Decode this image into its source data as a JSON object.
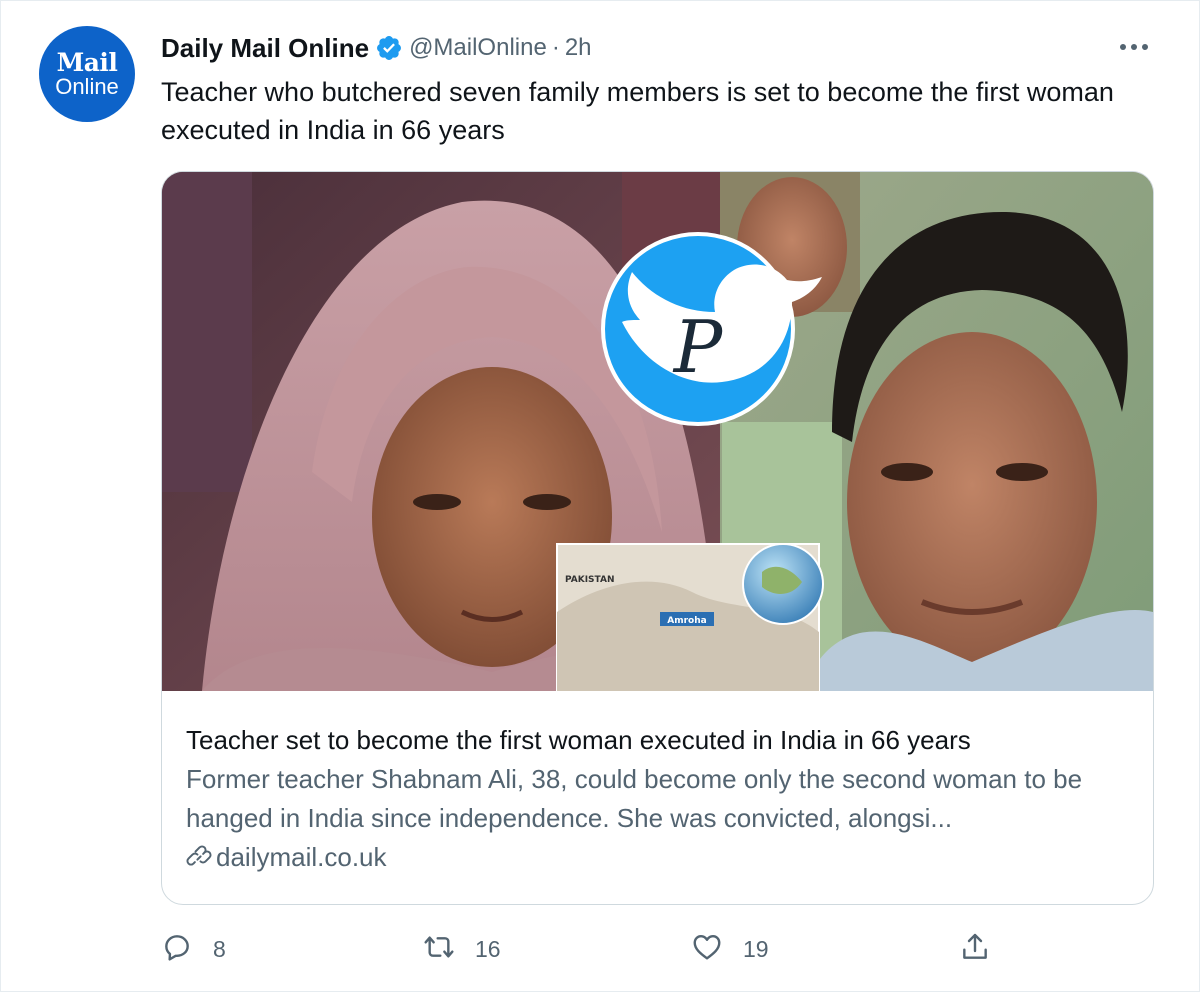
{
  "account": {
    "avatar_line1": "Mail",
    "avatar_line2": "Online",
    "display_name": "Daily Mail Online",
    "handle": "@MailOnline",
    "separator": "·",
    "time": "2h"
  },
  "tweet": {
    "text": "Teacher who butchered seven family members is set to become the first woman executed in India in 66 years"
  },
  "card": {
    "title": "Teacher set to become the first woman executed in India in 66 years",
    "description": "Former teacher Shabnam Ali, 38, could become only the second woman to be hanged in India since independence. She was convicted, alongsi...",
    "domain": "dailymail.co.uk",
    "map_labels": {
      "country": "PAKISTAN",
      "town": "Amroha"
    },
    "watermark_letter": "P"
  },
  "actions": {
    "reply": {
      "icon": "reply-icon",
      "count": "8"
    },
    "retweet": {
      "icon": "retweet-icon",
      "count": "16"
    },
    "like": {
      "icon": "heart-icon",
      "count": "19"
    },
    "share": {
      "icon": "share-icon"
    }
  },
  "colors": {
    "brand_blue": "#0d63c9",
    "verified_blue": "#1d9bf0",
    "text_primary": "#0f1419",
    "text_secondary": "#536471",
    "card_border": "#cfd9de"
  }
}
